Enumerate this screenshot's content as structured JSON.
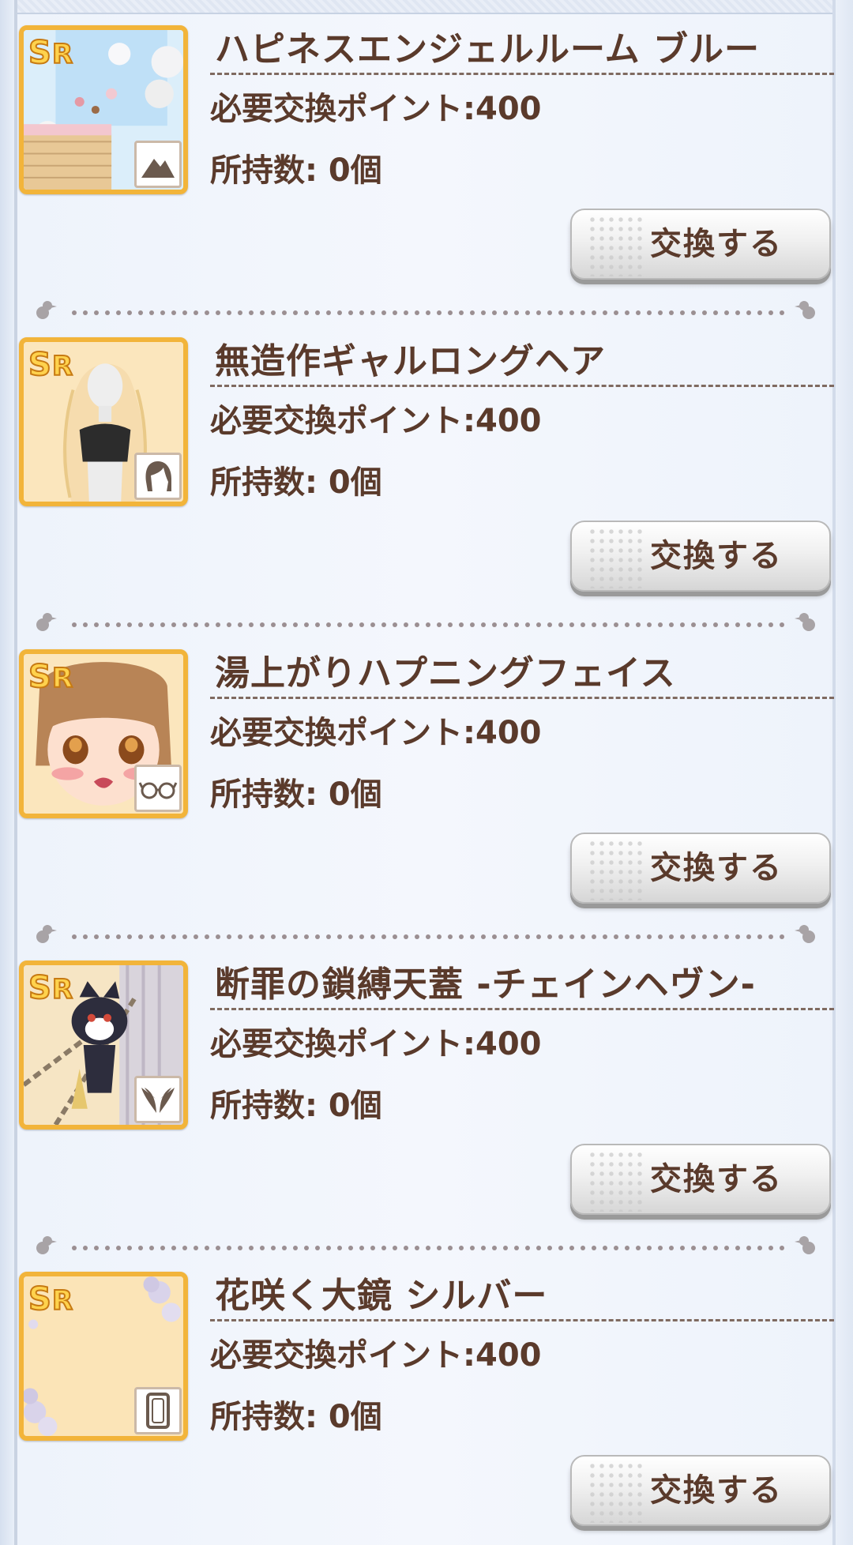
{
  "items": [
    {
      "rarity": "SR",
      "name": "ハピネスエンジェルルーム ブルー",
      "cost": "必要交換ポイント:400",
      "owned": "所持数: 0個",
      "type_icon": "mountain-icon",
      "button_label": "交換する"
    },
    {
      "rarity": "SR",
      "name": "無造作ギャルロングヘア",
      "cost": "必要交換ポイント:400",
      "owned": "所持数: 0個",
      "type_icon": "hair-icon",
      "button_label": "交換する"
    },
    {
      "rarity": "SR",
      "name": "湯上がりハプニングフェイス",
      "cost": "必要交換ポイント:400",
      "owned": "所持数: 0個",
      "type_icon": "glasses-icon",
      "button_label": "交換する"
    },
    {
      "rarity": "SR",
      "name": "断罪の鎖縛天蓋 -チェインヘヴン-",
      "cost": "必要交換ポイント:400",
      "owned": "所持数: 0個",
      "type_icon": "wings-icon",
      "button_label": "交換する"
    },
    {
      "rarity": "SR",
      "name": "花咲く大鏡 シルバー",
      "cost": "必要交換ポイント:400",
      "owned": "所持数: 0個",
      "type_icon": "mirror-frame-icon",
      "button_label": "交換する"
    }
  ],
  "colors": {
    "text": "#5a3a2b",
    "frame_gold": "#f2b43a",
    "background": "#eef3fb"
  }
}
